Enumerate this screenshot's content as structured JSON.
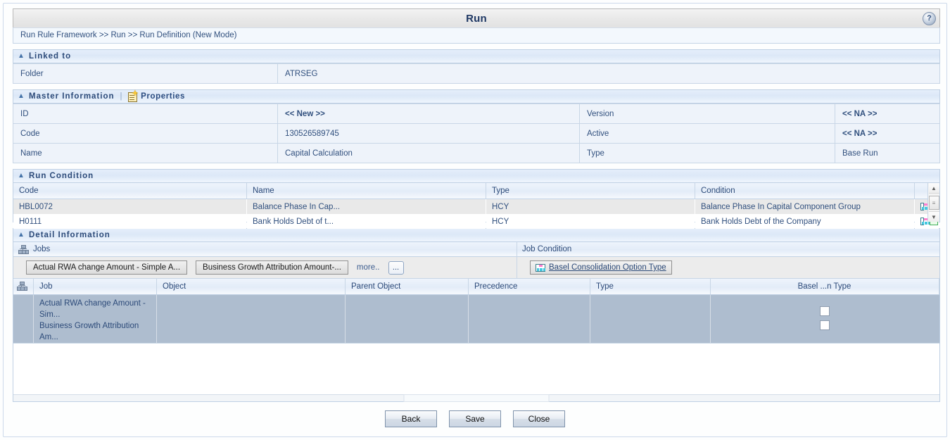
{
  "window": {
    "title": "Run",
    "help_icon": "help-circle-icon",
    "breadcrumb": "Run Rule Framework >> Run >> Run Definition (New Mode)"
  },
  "linked_to": {
    "section_title": "Linked to",
    "collapse_icon": "chevron-up-icon",
    "rows": [
      {
        "label": "Folder",
        "value": "ATRSEG"
      }
    ]
  },
  "master_information": {
    "section_title": "Master Information",
    "collapse_icon": "chevron-up-icon",
    "separator": "|",
    "properties_label": "Properties",
    "properties_icon": "properties-document-icon",
    "rows": [
      {
        "label_left": "ID",
        "value_left": "<< New >>",
        "label_right": "Version",
        "value_right": "<< NA >>"
      },
      {
        "label_left": "Code",
        "value_left": "130526589745",
        "label_right": "Active",
        "value_right": "<< NA >>"
      },
      {
        "label_left": "Name",
        "value_left": "Capital Calculation",
        "label_right": "Type",
        "value_right": "Base Run"
      }
    ]
  },
  "run_condition": {
    "section_title": "Run Condition",
    "collapse_icon": "chevron-up-icon",
    "columns": [
      "Code",
      "Name",
      "Type",
      "Condition",
      ""
    ],
    "rows": [
      {
        "code": "HBL0072",
        "name": "Balance Phase In Cap...",
        "type": "HCY",
        "condition": "Balance Phase In Capital Component Group",
        "hierarchy_icon": "hierarchy-icon",
        "filter_icon": "filter-icon"
      },
      {
        "code": "H0111",
        "name": "Bank Holds Debt of t...",
        "type": "HCY",
        "condition": "Bank Holds Debt of the Company",
        "hierarchy_icon": "hierarchy-icon",
        "filter_icon": "filter-icon"
      }
    ],
    "scrollbar": {
      "up_arrow": "▲",
      "thumb": "≡",
      "down_arrow": "▼"
    }
  },
  "detail_information": {
    "section_title": "Detail Information",
    "collapse_icon": "chevron-up-icon",
    "jobs_panel": {
      "title": "Jobs",
      "icon": "org-chart-icon",
      "chips": [
        "Actual RWA change Amount - Simple A...",
        "Business Growth Attribution Amount-..."
      ],
      "more_label": "more..",
      "ellipsis_button": "..."
    },
    "job_condition_panel": {
      "title": "Job Condition",
      "button_label": "Basel Consolidation Option Type",
      "button_icon": "hierarchy-icon"
    },
    "jobs_table": {
      "header_icon": "org-chart-icon",
      "columns": [
        "Job",
        "Object",
        "Parent Object",
        "Precedence",
        "Type",
        "Basel ...n Type"
      ],
      "rows": [
        {
          "job_lines": [
            "Actual RWA change Amount -",
            "Sim..."
          ],
          "object": "",
          "parent_object": "",
          "precedence": "",
          "type": "",
          "checkbox": false
        },
        {
          "job_lines": [
            "Business Growth Attribution",
            "Am..."
          ],
          "object": "",
          "parent_object": "",
          "precedence": "",
          "type": "",
          "checkbox": false
        }
      ]
    }
  },
  "footer": {
    "back_label": "Back",
    "save_label": "Save",
    "close_label": "Close"
  }
}
